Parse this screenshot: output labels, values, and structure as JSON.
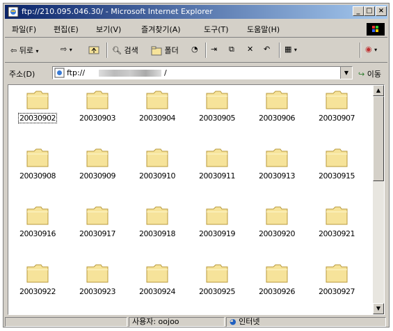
{
  "window": {
    "title": "ftp://210.095.046.30/ - Microsoft Internet Explorer",
    "min_label": "_",
    "max_label": "□",
    "close_label": "×"
  },
  "menu": [
    "파일(F)",
    "편집(E)",
    "보기(V)",
    "즐겨찾기(A)",
    "도구(T)",
    "도움말(H)"
  ],
  "toolbar": {
    "back_label": "뒤로",
    "search_label": "검색",
    "folders_label": "폴더"
  },
  "address": {
    "label": "주소(D)",
    "value": "ftp://",
    "trailing": "/",
    "go_label": "이동"
  },
  "folders": [
    "20030902",
    "20030903",
    "20030904",
    "20030905",
    "20030906",
    "20030907",
    "20030908",
    "20030909",
    "20030910",
    "20030911",
    "20030913",
    "20030915",
    "20030916",
    "20030917",
    "20030918",
    "20030919",
    "20030920",
    "20030921",
    "20030922",
    "20030923",
    "20030924",
    "20030925",
    "20030926",
    "20030927"
  ],
  "status": {
    "user": "사용자: oojoo",
    "zone": "인터넷"
  },
  "colors": {
    "title_start": "#0a246a",
    "title_end": "#a6caf0",
    "folder_fill": "#f6e39a",
    "folder_stroke": "#b89a3c",
    "chrome": "#d4d0c8"
  }
}
